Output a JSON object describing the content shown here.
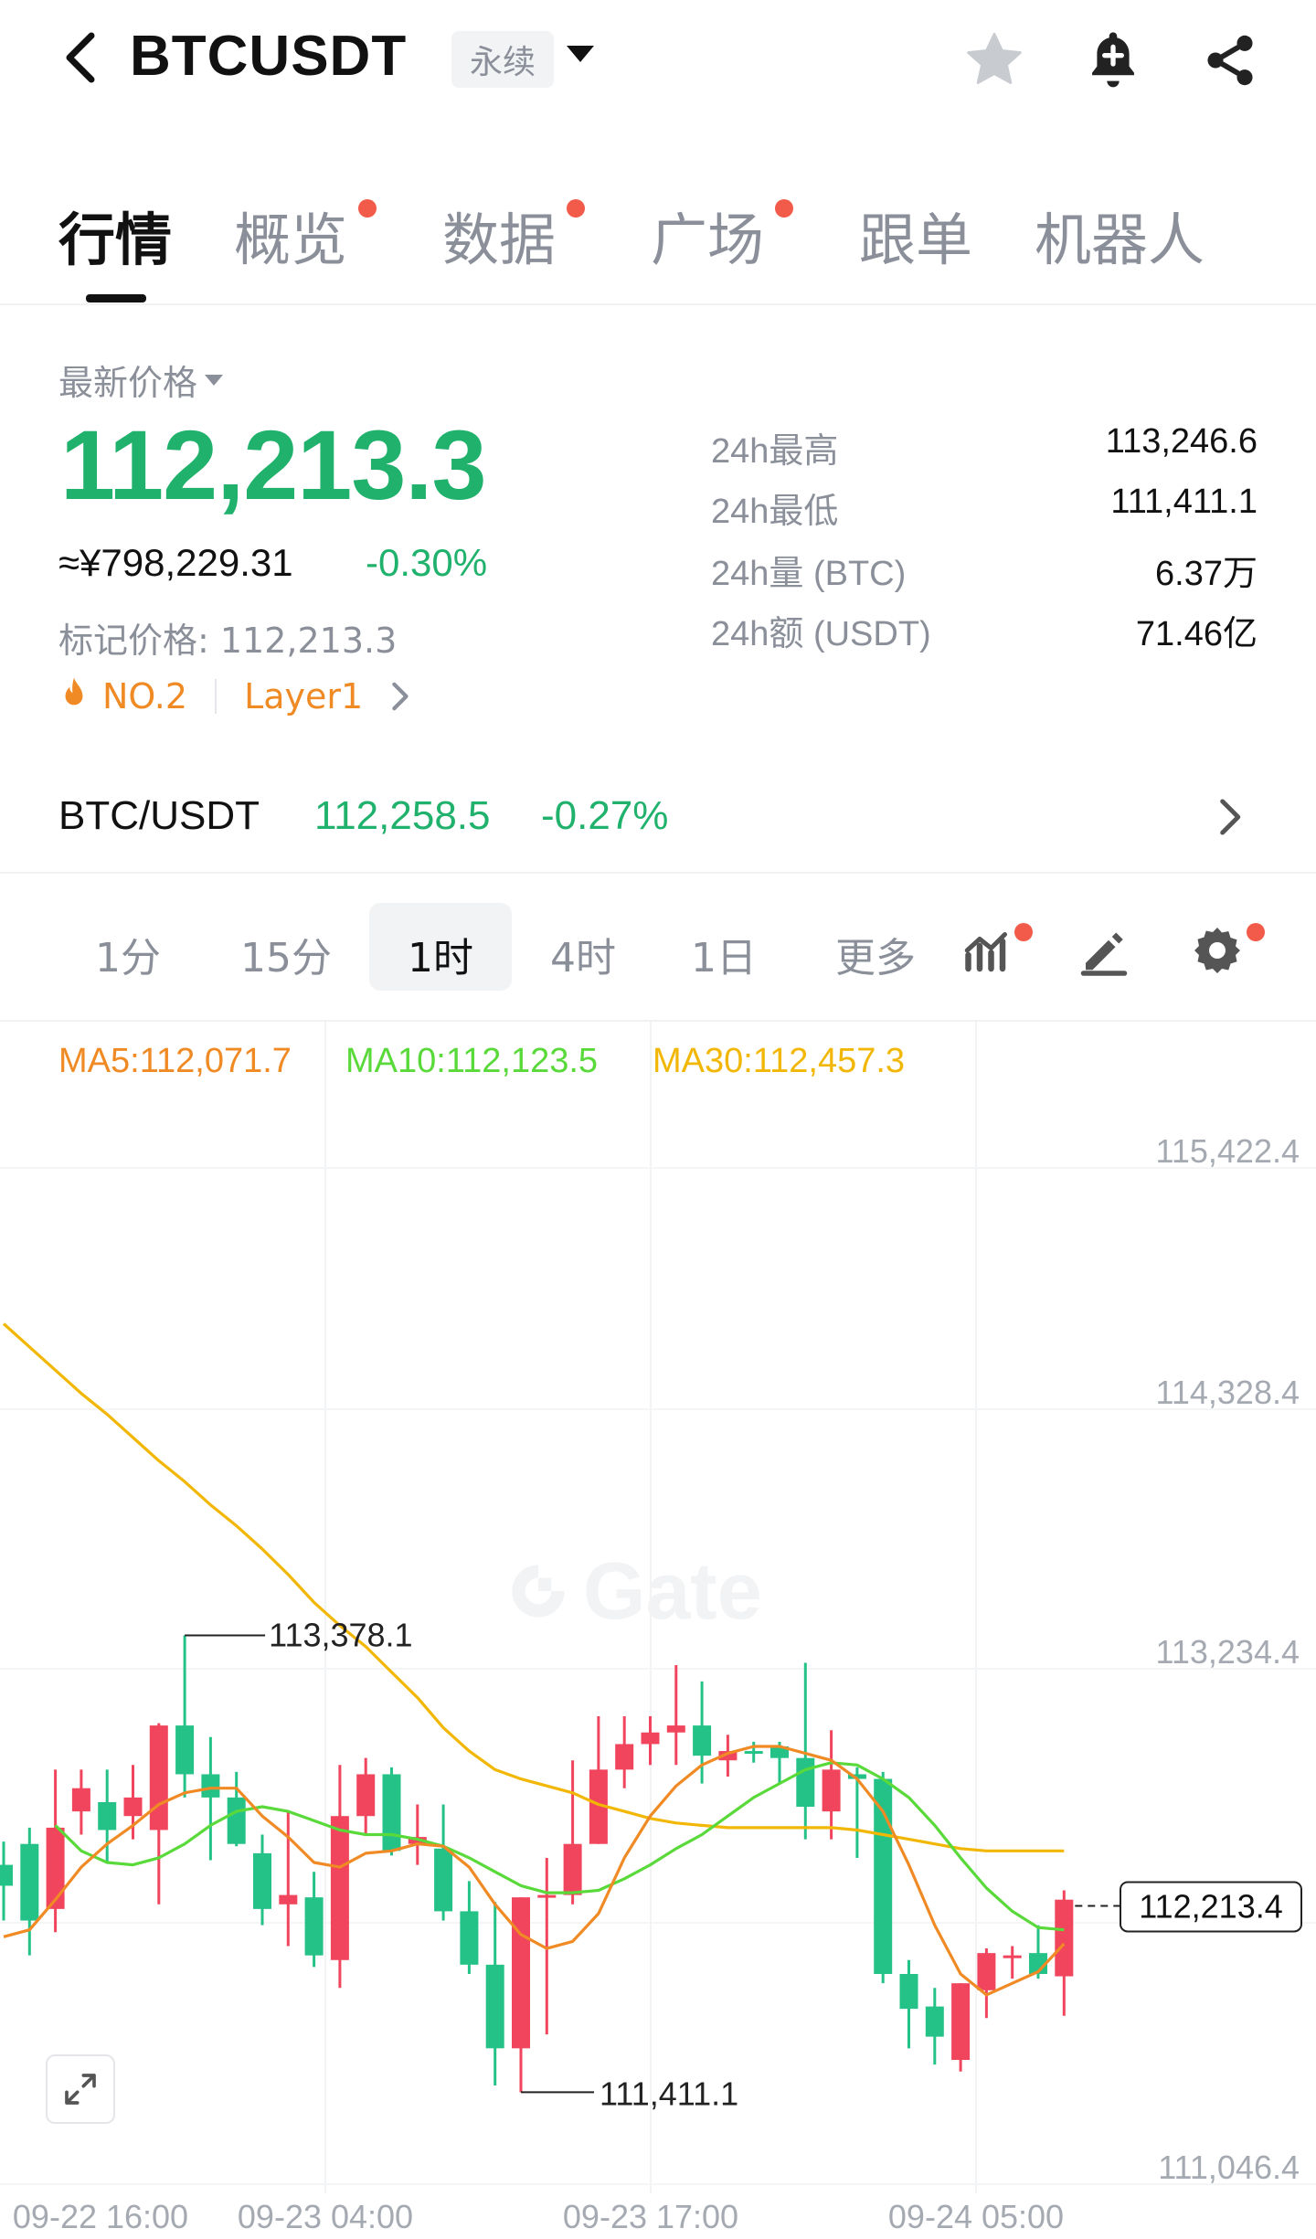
{
  "header": {
    "symbol": "BTCUSDT",
    "contract_type": "永续",
    "icons": [
      "back-icon",
      "star-icon",
      "bell-plus-icon",
      "share-icon"
    ]
  },
  "tabs": [
    {
      "label": "行情",
      "active": true,
      "dot": false
    },
    {
      "label": "概览",
      "active": false,
      "dot": true
    },
    {
      "label": "数据",
      "active": false,
      "dot": true
    },
    {
      "label": "广场",
      "active": false,
      "dot": true
    },
    {
      "label": "跟单",
      "active": false,
      "dot": false
    },
    {
      "label": "机器人",
      "active": false,
      "dot": false
    }
  ],
  "price": {
    "label": "最新价格",
    "last": "112,213.3",
    "cny": "≈¥798,229.31",
    "change_pct": "-0.30%",
    "mark_label": "标记价格: 112,213.3",
    "rank": "NO.2",
    "category": "Layer1"
  },
  "stats": [
    {
      "label": "24h最高",
      "value": "113,246.6"
    },
    {
      "label": "24h最低",
      "value": "111,411.1"
    },
    {
      "label": "24h量 (BTC)",
      "value": "6.37万"
    },
    {
      "label": "24h额 (USDT)",
      "value": "71.46亿"
    }
  ],
  "spot": {
    "pair": "BTC/USDT",
    "price": "112,258.5",
    "change_pct": "-0.27%"
  },
  "intervals": [
    {
      "label": "1分",
      "active": false
    },
    {
      "label": "15分",
      "active": false
    },
    {
      "label": "1时",
      "active": true
    },
    {
      "label": "4时",
      "active": false
    },
    {
      "label": "1日",
      "active": false
    },
    {
      "label": "更多",
      "active": false
    }
  ],
  "ma_legend": {
    "ma5": "MA5:112,071.7",
    "ma10": "MA10:112,123.5",
    "ma30": "MA30:112,457.3"
  },
  "colors": {
    "up": "#f0455c",
    "down": "#25c287",
    "ma5": "#f08a24",
    "ma10": "#5ad93a",
    "ma30": "#f2b705"
  },
  "watermark": "Gate",
  "chart_data": {
    "type": "candlestick",
    "y_ticks": [
      "115,422.4",
      "114,328.4",
      "113,234.4",
      "111,046.4"
    ],
    "x_ticks": [
      "09-22 16:00",
      "09-23 04:00",
      "09-23 17:00",
      "09-24 05:00"
    ],
    "ylim": [
      111046.4,
      115422.4
    ],
    "high_label": "113,378.1",
    "low_label": "111,411.1",
    "current_label": "112,213.4",
    "candles": [
      {
        "o": 112390,
        "h": 112490,
        "l": 112150,
        "c": 112300
      },
      {
        "o": 112480,
        "h": 112550,
        "l": 112000,
        "c": 112150
      },
      {
        "o": 112200,
        "h": 112800,
        "l": 112100,
        "c": 112550
      },
      {
        "o": 112620,
        "h": 112800,
        "l": 112520,
        "c": 112720
      },
      {
        "o": 112660,
        "h": 112800,
        "l": 112400,
        "c": 112540
      },
      {
        "o": 112600,
        "h": 112820,
        "l": 112500,
        "c": 112680
      },
      {
        "o": 112540,
        "h": 113000,
        "l": 112220,
        "c": 112990
      },
      {
        "o": 112990,
        "h": 113378,
        "l": 112680,
        "c": 112780
      },
      {
        "o": 112780,
        "h": 112940,
        "l": 112410,
        "c": 112680
      },
      {
        "o": 112680,
        "h": 112790,
        "l": 112470,
        "c": 112480
      },
      {
        "o": 112440,
        "h": 112520,
        "l": 112130,
        "c": 112200
      },
      {
        "o": 112220,
        "h": 112620,
        "l": 112040,
        "c": 112260
      },
      {
        "o": 112250,
        "h": 112360,
        "l": 111950,
        "c": 112000
      },
      {
        "o": 111980,
        "h": 112820,
        "l": 111860,
        "c": 112600
      },
      {
        "o": 112600,
        "h": 112850,
        "l": 112520,
        "c": 112780
      },
      {
        "o": 112780,
        "h": 112810,
        "l": 112430,
        "c": 112450
      },
      {
        "o": 112480,
        "h": 112650,
        "l": 112390,
        "c": 112510
      },
      {
        "o": 112460,
        "h": 112650,
        "l": 112150,
        "c": 112190
      },
      {
        "o": 112190,
        "h": 112320,
        "l": 111920,
        "c": 111960
      },
      {
        "o": 111960,
        "h": 112230,
        "l": 111440,
        "c": 111600
      },
      {
        "o": 111600,
        "h": 112250,
        "l": 111411,
        "c": 112250
      },
      {
        "o": 112250,
        "h": 112420,
        "l": 111660,
        "c": 112260
      },
      {
        "o": 112260,
        "h": 112840,
        "l": 112220,
        "c": 112480
      },
      {
        "o": 112480,
        "h": 113030,
        "l": 112480,
        "c": 112800
      },
      {
        "o": 112800,
        "h": 113030,
        "l": 112720,
        "c": 112910
      },
      {
        "o": 112910,
        "h": 113030,
        "l": 112820,
        "c": 112960
      },
      {
        "o": 112960,
        "h": 113250,
        "l": 112820,
        "c": 112990
      },
      {
        "o": 112990,
        "h": 113180,
        "l": 112740,
        "c": 112860
      },
      {
        "o": 112840,
        "h": 112950,
        "l": 112770,
        "c": 112880
      },
      {
        "o": 112880,
        "h": 112920,
        "l": 112830,
        "c": 112870
      },
      {
        "o": 112900,
        "h": 112920,
        "l": 112740,
        "c": 112850
      },
      {
        "o": 112850,
        "h": 113260,
        "l": 112500,
        "c": 112640
      },
      {
        "o": 112620,
        "h": 112970,
        "l": 112500,
        "c": 112800
      },
      {
        "o": 112780,
        "h": 112810,
        "l": 112420,
        "c": 112760
      },
      {
        "o": 112760,
        "h": 112790,
        "l": 111880,
        "c": 111920
      },
      {
        "o": 111920,
        "h": 111980,
        "l": 111600,
        "c": 111770
      },
      {
        "o": 111780,
        "h": 111860,
        "l": 111530,
        "c": 111650
      },
      {
        "o": 111550,
        "h": 111880,
        "l": 111500,
        "c": 111880
      },
      {
        "o": 111850,
        "h": 112030,
        "l": 111730,
        "c": 112010
      },
      {
        "o": 111990,
        "h": 112040,
        "l": 111900,
        "c": 112000
      },
      {
        "o": 112010,
        "h": 112130,
        "l": 111900,
        "c": 111920
      },
      {
        "o": 111910,
        "h": 112280,
        "l": 111740,
        "c": 112240
      }
    ],
    "ma5": [
      112080,
      112110,
      112240,
      112380,
      112480,
      112560,
      112650,
      112700,
      112720,
      112720,
      112600,
      112510,
      112400,
      112380,
      112440,
      112450,
      112480,
      112470,
      112380,
      112220,
      112090,
      112030,
      112060,
      112180,
      112420,
      112600,
      112730,
      112820,
      112870,
      112900,
      112900,
      112870,
      112840,
      112760,
      112620,
      112390,
      112130,
      111920,
      111830,
      111880,
      111930,
      112050
    ],
    "ma10": [
      null,
      null,
      112560,
      112450,
      112400,
      112390,
      112420,
      112480,
      112560,
      112620,
      112640,
      112620,
      112580,
      112540,
      112520,
      112520,
      112500,
      112470,
      112420,
      112360,
      112300,
      112270,
      112270,
      112280,
      112330,
      112390,
      112460,
      112520,
      112600,
      112680,
      112740,
      112800,
      112830,
      112820,
      112760,
      112680,
      112560,
      112420,
      112290,
      112190,
      112120,
      112110
    ],
    "ma30": [
      114720,
      114620,
      114520,
      114420,
      114330,
      114230,
      114130,
      114040,
      113940,
      113850,
      113750,
      113640,
      113520,
      113420,
      113330,
      113220,
      113110,
      112980,
      112880,
      112800,
      112760,
      112730,
      112700,
      112650,
      112620,
      112590,
      112570,
      112560,
      112550,
      112550,
      112550,
      112550,
      112550,
      112540,
      112520,
      112500,
      112480,
      112460,
      112450,
      112450,
      112450,
      112450
    ]
  }
}
